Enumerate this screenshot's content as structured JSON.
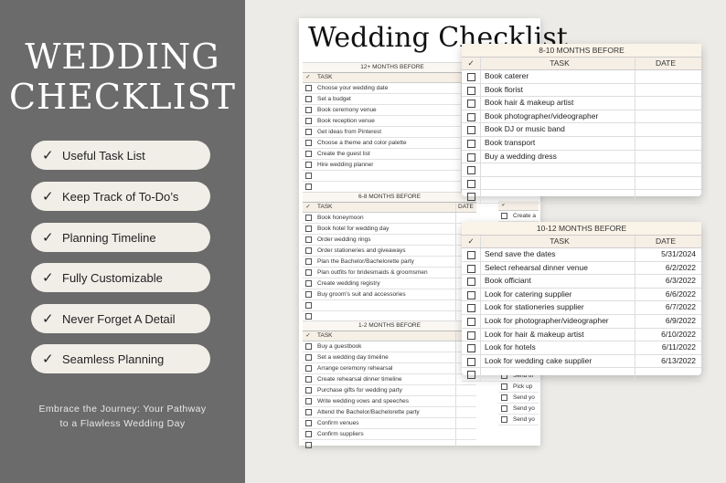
{
  "promo": {
    "title_line1": "WEDDING",
    "title_line2": "CHECKLIST",
    "features": [
      {
        "label": "Useful Task List"
      },
      {
        "label": "Keep Track of  To-Do’s"
      },
      {
        "label": "Planning Timeline"
      },
      {
        "label": "Fully Customizable"
      },
      {
        "label": "Never Forget A Detail"
      },
      {
        "label": "Seamless Planning"
      }
    ],
    "check_glyph": "✓",
    "tagline_line1": "Embrace the Journey: Your Pathway",
    "tagline_line2": "to a Flawless Wedding Day"
  },
  "sheet": {
    "title": "Wedding Checklist",
    "sections": [
      {
        "header": "12+ MONTHS BEFORE",
        "col_check": "✓",
        "col_task": "TASK",
        "col_date": "DATE",
        "rows": [
          {
            "task": "Choose your wedding date",
            "date": "5/"
          },
          {
            "task": "Set a budget",
            "date": "5/"
          },
          {
            "task": "Book ceremony venue",
            "date": "5/"
          },
          {
            "task": "Book reception venue",
            "date": "5/"
          },
          {
            "task": "Get ideas from Pinterest",
            "date": "5/"
          },
          {
            "task": "Choose a theme and color palette",
            "date": "5/"
          },
          {
            "task": "Create the guest list",
            "date": "5/"
          },
          {
            "task": "Hire wedding planner",
            "date": "5/"
          },
          {
            "task": "",
            "date": ""
          },
          {
            "task": "",
            "date": ""
          }
        ]
      },
      {
        "header": "6-8 MONTHS BEFORE",
        "col_check": "✓",
        "col_task": "TASK",
        "col_date": "DATE",
        "rows": [
          {
            "task": "Book honeymoon",
            "date": ""
          },
          {
            "task": "Book hotel for wedding day",
            "date": ""
          },
          {
            "task": "Order wedding rings",
            "date": ""
          },
          {
            "task": "Order stationeries and giveaways",
            "date": ""
          },
          {
            "task": "Plan the Bachelor/Bachelorette party",
            "date": ""
          },
          {
            "task": "Plan outfits for bridesmaids & groomsmen",
            "date": ""
          },
          {
            "task": "Create wedding registry",
            "date": ""
          },
          {
            "task": "Buy groom's suit and accessories",
            "date": ""
          },
          {
            "task": "",
            "date": ""
          },
          {
            "task": "",
            "date": ""
          }
        ]
      },
      {
        "header": "1-2 MONTHS BEFORE",
        "col_check": "✓",
        "col_task": "TASK",
        "col_date": "",
        "rows": [
          {
            "task": "Buy a guestbook",
            "date": ""
          },
          {
            "task": "Set a wedding day timeline",
            "date": ""
          },
          {
            "task": "Arrange ceremony rehearsal",
            "date": ""
          },
          {
            "task": "Create rehearsal dinner timeline",
            "date": ""
          },
          {
            "task": "Purchase gifts for wedding party",
            "date": ""
          },
          {
            "task": "Write wedding vows and speeches",
            "date": ""
          },
          {
            "task": "Attend the Bachelor/Bachelorette party",
            "date": ""
          },
          {
            "task": "Confirm venues",
            "date": ""
          },
          {
            "task": "Confirm suppliers",
            "date": ""
          },
          {
            "task": "",
            "date": ""
          }
        ]
      }
    ],
    "peek_top": {
      "task": "Create a"
    },
    "peek_bottom": [
      {
        "task": "Send th"
      },
      {
        "task": "Pick up"
      },
      {
        "task": "Send yo"
      },
      {
        "task": "Send yo"
      },
      {
        "task": "Send yo"
      }
    ]
  },
  "card1": {
    "header": "8-10 MONTHS BEFORE",
    "col_check": "✓",
    "col_task": "TASK",
    "col_date": "DATE",
    "rows": [
      {
        "task": "Book caterer",
        "date": ""
      },
      {
        "task": "Book florist",
        "date": ""
      },
      {
        "task": "Book hair & makeup artist",
        "date": ""
      },
      {
        "task": "Book photographer/videographer",
        "date": ""
      },
      {
        "task": "Book DJ or music band",
        "date": ""
      },
      {
        "task": "Book transport",
        "date": ""
      },
      {
        "task": "Buy a wedding dress",
        "date": ""
      },
      {
        "task": "",
        "date": ""
      },
      {
        "task": "",
        "date": ""
      },
      {
        "task": "",
        "date": ""
      }
    ]
  },
  "card2": {
    "header": "10-12 MONTHS BEFORE",
    "col_check": "✓",
    "col_task": "TASK",
    "col_date": "DATE",
    "rows": [
      {
        "task": "Send save the dates",
        "date": "5/31/2024"
      },
      {
        "task": "Select rehearsal dinner venue",
        "date": "6/2/2022"
      },
      {
        "task": "Book officiant",
        "date": "6/3/2022"
      },
      {
        "task": "Look for catering supplier",
        "date": "6/6/2022"
      },
      {
        "task": "Look for stationeries supplier",
        "date": "6/7/2022"
      },
      {
        "task": "Look for photographer/videographer",
        "date": "6/9/2022"
      },
      {
        "task": "Look for hair & makeup artist",
        "date": "6/10/2022"
      },
      {
        "task": "Look for hotels",
        "date": "6/11/2022"
      },
      {
        "task": "Look for wedding cake supplier",
        "date": "6/13/2022"
      },
      {
        "task": "",
        "date": ""
      }
    ]
  }
}
